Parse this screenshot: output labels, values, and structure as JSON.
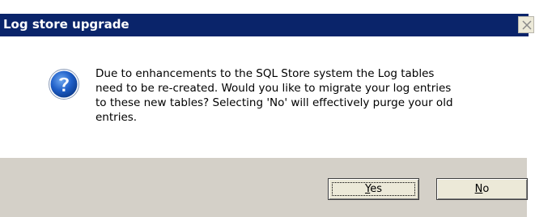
{
  "window": {
    "title": "Log store upgrade",
    "close_icon": "close-x-icon"
  },
  "dialog": {
    "icon": "question-icon",
    "message_lines": [
      "Due to enhancements to the SQL Store system the Log tables",
      "need to be re-created. Would you like to migrate your log entries",
      "to these new tables? Selecting 'No' will effectively purge your old",
      "entries."
    ]
  },
  "buttons": {
    "yes": {
      "accel": "Y",
      "rest": "es"
    },
    "no": {
      "accel": "N",
      "rest": "o"
    }
  },
  "colors": {
    "titlebar": "#0a246a",
    "footer": "#d4d0c8",
    "icon_blue": "#1a5bc4"
  }
}
